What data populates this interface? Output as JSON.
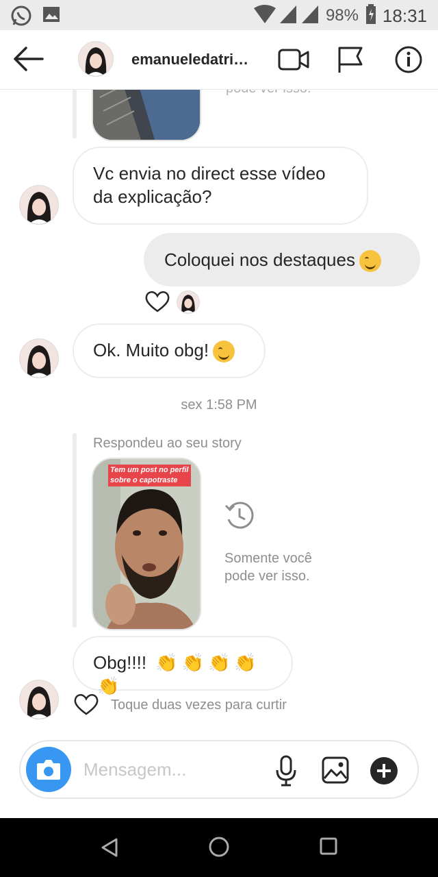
{
  "status_bar": {
    "battery": "98%",
    "time": "18:31",
    "left_icons": [
      "whatsapp-icon",
      "image-notification-icon"
    ],
    "right_icons": [
      "wifi-icon",
      "signal-icon",
      "signal-icon",
      "battery-icon"
    ]
  },
  "header": {
    "back_icon": "arrow-left-icon",
    "username": "emanueledatri…",
    "actions": [
      "video-call-icon",
      "flag-icon",
      "info-icon"
    ]
  },
  "messages": {
    "top_story_note": "pode ver isso.",
    "msg1": {
      "line1": "Vc envia no direct esse vídeo",
      "line2": "da explicação?"
    },
    "msg2": {
      "text": "Coloquei nos destaques",
      "emoji": "winking-face"
    },
    "msg3": {
      "text": "Ok. Muito obg!",
      "emoji": "winking-face"
    },
    "timestamp": "sex 1:58 PM",
    "story_reply": {
      "label": "Respondeu ao seu story",
      "caption_line1": "Tem um post no perfil",
      "caption_line2": "sobre o capotraste",
      "note_line1": "Somente você",
      "note_line2": "pode ver isso."
    },
    "msg4": {
      "text": "Obg!!!!",
      "emoji_count": "5",
      "emoji": "clapping-hands"
    },
    "like_hint": "Toque duas vezes para curtir"
  },
  "composer": {
    "placeholder": "Mensagem...",
    "icons": [
      "camera-icon",
      "microphone-icon",
      "gallery-icon",
      "plus-circle-icon"
    ]
  },
  "nav": {
    "icons": [
      "back-triangle-icon",
      "home-circle-icon",
      "recents-square-icon"
    ]
  },
  "colors": {
    "accent": "#3897f0",
    "bubble_outgoing": "#ececec",
    "muted_text": "#8e8e8e"
  }
}
